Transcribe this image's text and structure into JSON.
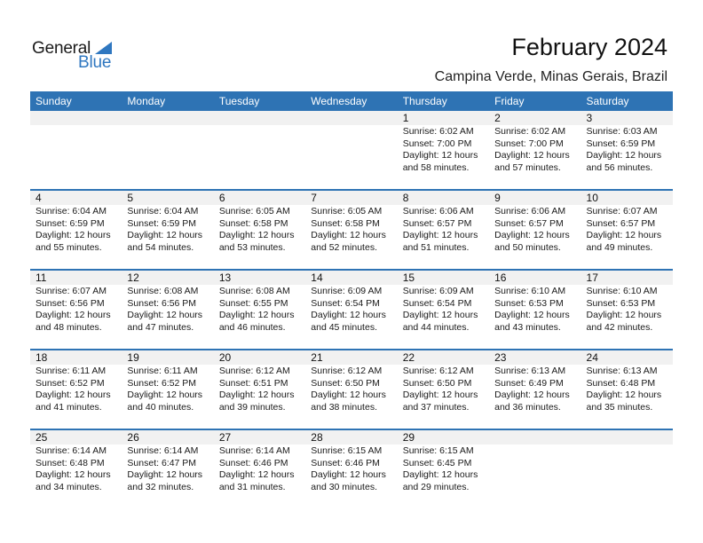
{
  "logo": {
    "line1": "General",
    "line2": "Blue"
  },
  "header": {
    "title": "February 2024",
    "location": "Campina Verde, Minas Gerais, Brazil"
  },
  "colors": {
    "accent": "#2e73b4",
    "band": "#f1f1f1"
  },
  "weekdays": [
    "Sunday",
    "Monday",
    "Tuesday",
    "Wednesday",
    "Thursday",
    "Friday",
    "Saturday"
  ],
  "weeks": [
    [
      {
        "day": "",
        "sunrise": "",
        "sunset": "",
        "daylight": "",
        "minutes": ""
      },
      {
        "day": "",
        "sunrise": "",
        "sunset": "",
        "daylight": "",
        "minutes": ""
      },
      {
        "day": "",
        "sunrise": "",
        "sunset": "",
        "daylight": "",
        "minutes": ""
      },
      {
        "day": "",
        "sunrise": "",
        "sunset": "",
        "daylight": "",
        "minutes": ""
      },
      {
        "day": "1",
        "sunrise": "Sunrise: 6:02 AM",
        "sunset": "Sunset: 7:00 PM",
        "daylight": "Daylight: 12 hours",
        "minutes": "and 58 minutes."
      },
      {
        "day": "2",
        "sunrise": "Sunrise: 6:02 AM",
        "sunset": "Sunset: 7:00 PM",
        "daylight": "Daylight: 12 hours",
        "minutes": "and 57 minutes."
      },
      {
        "day": "3",
        "sunrise": "Sunrise: 6:03 AM",
        "sunset": "Sunset: 6:59 PM",
        "daylight": "Daylight: 12 hours",
        "minutes": "and 56 minutes."
      }
    ],
    [
      {
        "day": "4",
        "sunrise": "Sunrise: 6:04 AM",
        "sunset": "Sunset: 6:59 PM",
        "daylight": "Daylight: 12 hours",
        "minutes": "and 55 minutes."
      },
      {
        "day": "5",
        "sunrise": "Sunrise: 6:04 AM",
        "sunset": "Sunset: 6:59 PM",
        "daylight": "Daylight: 12 hours",
        "minutes": "and 54 minutes."
      },
      {
        "day": "6",
        "sunrise": "Sunrise: 6:05 AM",
        "sunset": "Sunset: 6:58 PM",
        "daylight": "Daylight: 12 hours",
        "minutes": "and 53 minutes."
      },
      {
        "day": "7",
        "sunrise": "Sunrise: 6:05 AM",
        "sunset": "Sunset: 6:58 PM",
        "daylight": "Daylight: 12 hours",
        "minutes": "and 52 minutes."
      },
      {
        "day": "8",
        "sunrise": "Sunrise: 6:06 AM",
        "sunset": "Sunset: 6:57 PM",
        "daylight": "Daylight: 12 hours",
        "minutes": "and 51 minutes."
      },
      {
        "day": "9",
        "sunrise": "Sunrise: 6:06 AM",
        "sunset": "Sunset: 6:57 PM",
        "daylight": "Daylight: 12 hours",
        "minutes": "and 50 minutes."
      },
      {
        "day": "10",
        "sunrise": "Sunrise: 6:07 AM",
        "sunset": "Sunset: 6:57 PM",
        "daylight": "Daylight: 12 hours",
        "minutes": "and 49 minutes."
      }
    ],
    [
      {
        "day": "11",
        "sunrise": "Sunrise: 6:07 AM",
        "sunset": "Sunset: 6:56 PM",
        "daylight": "Daylight: 12 hours",
        "minutes": "and 48 minutes."
      },
      {
        "day": "12",
        "sunrise": "Sunrise: 6:08 AM",
        "sunset": "Sunset: 6:56 PM",
        "daylight": "Daylight: 12 hours",
        "minutes": "and 47 minutes."
      },
      {
        "day": "13",
        "sunrise": "Sunrise: 6:08 AM",
        "sunset": "Sunset: 6:55 PM",
        "daylight": "Daylight: 12 hours",
        "minutes": "and 46 minutes."
      },
      {
        "day": "14",
        "sunrise": "Sunrise: 6:09 AM",
        "sunset": "Sunset: 6:54 PM",
        "daylight": "Daylight: 12 hours",
        "minutes": "and 45 minutes."
      },
      {
        "day": "15",
        "sunrise": "Sunrise: 6:09 AM",
        "sunset": "Sunset: 6:54 PM",
        "daylight": "Daylight: 12 hours",
        "minutes": "and 44 minutes."
      },
      {
        "day": "16",
        "sunrise": "Sunrise: 6:10 AM",
        "sunset": "Sunset: 6:53 PM",
        "daylight": "Daylight: 12 hours",
        "minutes": "and 43 minutes."
      },
      {
        "day": "17",
        "sunrise": "Sunrise: 6:10 AM",
        "sunset": "Sunset: 6:53 PM",
        "daylight": "Daylight: 12 hours",
        "minutes": "and 42 minutes."
      }
    ],
    [
      {
        "day": "18",
        "sunrise": "Sunrise: 6:11 AM",
        "sunset": "Sunset: 6:52 PM",
        "daylight": "Daylight: 12 hours",
        "minutes": "and 41 minutes."
      },
      {
        "day": "19",
        "sunrise": "Sunrise: 6:11 AM",
        "sunset": "Sunset: 6:52 PM",
        "daylight": "Daylight: 12 hours",
        "minutes": "and 40 minutes."
      },
      {
        "day": "20",
        "sunrise": "Sunrise: 6:12 AM",
        "sunset": "Sunset: 6:51 PM",
        "daylight": "Daylight: 12 hours",
        "minutes": "and 39 minutes."
      },
      {
        "day": "21",
        "sunrise": "Sunrise: 6:12 AM",
        "sunset": "Sunset: 6:50 PM",
        "daylight": "Daylight: 12 hours",
        "minutes": "and 38 minutes."
      },
      {
        "day": "22",
        "sunrise": "Sunrise: 6:12 AM",
        "sunset": "Sunset: 6:50 PM",
        "daylight": "Daylight: 12 hours",
        "minutes": "and 37 minutes."
      },
      {
        "day": "23",
        "sunrise": "Sunrise: 6:13 AM",
        "sunset": "Sunset: 6:49 PM",
        "daylight": "Daylight: 12 hours",
        "minutes": "and 36 minutes."
      },
      {
        "day": "24",
        "sunrise": "Sunrise: 6:13 AM",
        "sunset": "Sunset: 6:48 PM",
        "daylight": "Daylight: 12 hours",
        "minutes": "and 35 minutes."
      }
    ],
    [
      {
        "day": "25",
        "sunrise": "Sunrise: 6:14 AM",
        "sunset": "Sunset: 6:48 PM",
        "daylight": "Daylight: 12 hours",
        "minutes": "and 34 minutes."
      },
      {
        "day": "26",
        "sunrise": "Sunrise: 6:14 AM",
        "sunset": "Sunset: 6:47 PM",
        "daylight": "Daylight: 12 hours",
        "minutes": "and 32 minutes."
      },
      {
        "day": "27",
        "sunrise": "Sunrise: 6:14 AM",
        "sunset": "Sunset: 6:46 PM",
        "daylight": "Daylight: 12 hours",
        "minutes": "and 31 minutes."
      },
      {
        "day": "28",
        "sunrise": "Sunrise: 6:15 AM",
        "sunset": "Sunset: 6:46 PM",
        "daylight": "Daylight: 12 hours",
        "minutes": "and 30 minutes."
      },
      {
        "day": "29",
        "sunrise": "Sunrise: 6:15 AM",
        "sunset": "Sunset: 6:45 PM",
        "daylight": "Daylight: 12 hours",
        "minutes": "and 29 minutes."
      },
      {
        "day": "",
        "sunrise": "",
        "sunset": "",
        "daylight": "",
        "minutes": ""
      },
      {
        "day": "",
        "sunrise": "",
        "sunset": "",
        "daylight": "",
        "minutes": ""
      }
    ]
  ]
}
